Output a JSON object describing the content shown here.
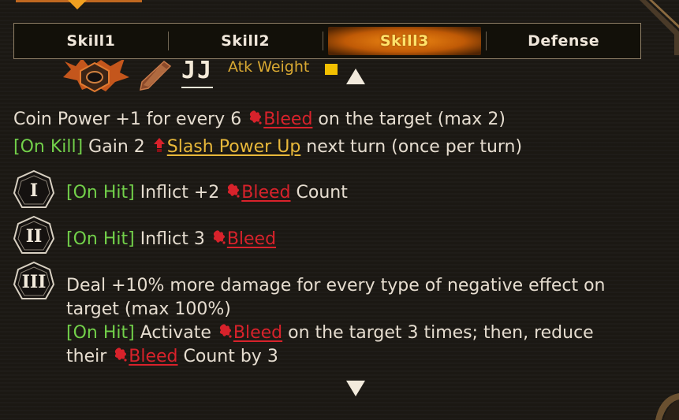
{
  "tabs": [
    {
      "label": "Skill1",
      "active": false
    },
    {
      "label": "Skill2",
      "active": false
    },
    {
      "label": "Skill3",
      "active": true
    },
    {
      "label": "Defense",
      "active": false
    }
  ],
  "header": {
    "level_text": "JJ",
    "atk_weight_label": "Atk Weight",
    "weight_color": "#f2c000"
  },
  "effects": {
    "line1": {
      "pre": "Coin Power +1 for every 6 ",
      "keyword": "Bleed",
      "post": " on the target (max 2)"
    },
    "line2": {
      "tag": "[On Kill]",
      "pre": " Gain 2 ",
      "keyword": "Slash Power Up",
      "post": " next turn (once per turn)"
    }
  },
  "coins": [
    {
      "numeral": "I",
      "tag": "[On Hit]",
      "pre": " Inflict +2 ",
      "keyword": "Bleed",
      "post": " Count"
    },
    {
      "numeral": "II",
      "tag": "[On Hit]",
      "pre": " Inflict 3 ",
      "keyword": "Bleed",
      "post": ""
    },
    {
      "numeral": "III",
      "line1": "Deal +10% more damage for every type of negative effect on",
      "line2": "target (max 100%)",
      "line3_tag": "[On Hit]",
      "line3_pre": " Activate ",
      "line3_keyword": "Bleed",
      "line3_post": " on the target 3 times; then, reduce",
      "line4_pre": "their ",
      "line4_keyword": "Bleed",
      "line4_post": " Count by 3"
    }
  ],
  "colors": {
    "bleed": "#d8222b",
    "on_hit": "#72d04a",
    "slash": "#e8b83a",
    "tab_active": "#f08a14"
  },
  "icons": [
    "bleed-icon",
    "slash-power-up-icon",
    "scroll-up-icon",
    "scroll-down-icon",
    "weapon-icon",
    "skill-emblem-icon"
  ]
}
